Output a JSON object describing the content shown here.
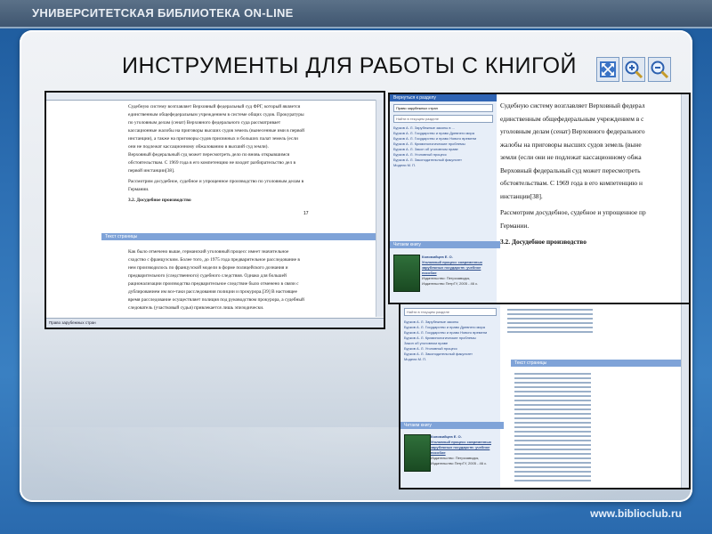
{
  "header": {
    "brand": "УНИВЕРСИТЕТСКАЯ БИБЛИОТЕКА ON-LINE"
  },
  "slide": {
    "title": "ИНСТРУМЕНТЫ ДЛЯ РАБОТЫ С КНИГОЙ"
  },
  "tools": [
    {
      "icon": "fit-page-icon"
    },
    {
      "icon": "zoom-in-icon"
    },
    {
      "icon": "zoom-out-icon"
    }
  ],
  "window1": {
    "paragraphs": [
      "Судебную систему возглавляет Верховный федеральный суд ФРГ, который является единственным общефедеральным учреждением в системе общих судов. Прокуратуры по уголовным делам (сенат) Верховного федерального суда рассматривает кассационные жалобы на приговоры высших судов земель (вынесенные ими в первой инстанции), а также на приговоры судов присяжных и больших палат земель (если они не подлежат кассационному обжалованию в высший суд земли).",
      "Верховный федеральный суд может пересмотреть дело по вновь открывшимся обстоятельствам. С 1969 года в его компетенцию не входит разбирательство дел в первой инстанции[38].",
      "Рассмотрим досудебное, судебное и упрощенное производство по уголовным делам в Германии.",
      "3.2. Досудебное производство"
    ],
    "page_number": "17",
    "section_header": "Текст страницы",
    "paragraphs2": [
      "Как было отмечено выше, германский уголовный процесс имеет значительное сходство с французским. Более того, до 1975 года предварительное расследование в нем производилось по французской модели в форме полицейского дознания и предварительного (следственного) судебного следствия. Однако для большей рационализации производства предварительное следствие было отменено в связи с дублированием им все-таки расследования полиции и прокурора.[39] В настоящее время расследование осуществляет полиция под руководством прокурора, а судебный следователь (участковый судья) привлекается лишь эпизодически."
    ],
    "status_bar": "Право зарубежных стран"
  },
  "window2": {
    "left_title": "Вернуться к разделу",
    "select": "Право зарубежных стран",
    "search_placeholder": "Найти в текущем разделе",
    "list": [
      "Бурков А. Л. Зарубежные законы в ...",
      "Бурков А. Л. Государство и право Древнего мира",
      "Бурков А. Л. Государство и право Нового времени",
      "Бурков А. Л. Криминологические проблемы",
      "Бурков А. Л. Закон об уголовном праве",
      "Бурков А. Л. Уголовный процесс",
      "Бурков А. Л. Законодательный факультет",
      "Модели М. П."
    ],
    "book_label": "Читаем книгу",
    "book_author": "Коломийцев Е. О.",
    "book_title": "Уголовный процесс современных зарубежных государств: учебное пособие",
    "book_meta": "Издательство: Петрозаводск, Издательство ПетрГУ, 2005 - 46 с.",
    "text_lines": [
      "Судебную систему возглавляет Верховный федерал",
      "единственным общефедеральным учреждением в с",
      "уголовным делам (сенат) Верховного федерального",
      "жалобы на приговоры высших судов земель (выне",
      "земли (если они не подлежат кассационному обжа",
      "Верховный федеральный суд может пересмотреть",
      "обстоятельствам. С 1969 года в его компетенцию н",
      "инстанции[38].",
      "Рассмотрим досудебное, судебное и упрощенное пр",
      "Германии.",
      "3.2. Досудебное производство"
    ]
  },
  "window3": {
    "search_placeholder": "Найти в текущем разделе",
    "list": [
      "Бурков А. Л. Зарубежные законы",
      "Бурков А. Л. Государство и право Древнего мира",
      "Бурков А. Л. Государство и право Нового времени",
      "Бурков А. Л. Криминологические проблемы",
      "Закон об уголовном праве",
      "Бурков А. Л. Уголовный процесс",
      "Бурков А. Л. Законодательный факультет",
      "Модели М. П."
    ],
    "page_header": "Текст страницы",
    "book_label": "Читаем книгу",
    "book_author": "Коломийцев Е. О.",
    "book_title": "Уголовный процесс современных зарубежных государств: учебное пособие",
    "book_meta": "Издательство: Петрозаводск, Издательство ПетрГУ, 2005 - 46 с."
  },
  "footer": {
    "url": "www.biblioclub.ru"
  }
}
